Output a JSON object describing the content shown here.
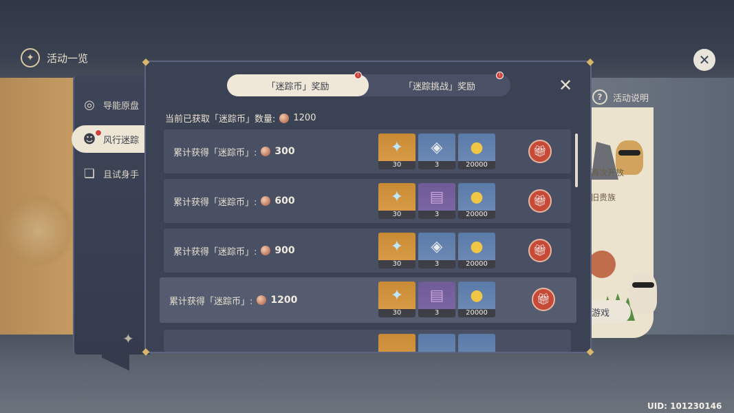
{
  "topbar": {
    "title": "活动一览",
    "close_icon": "close-circle-icon"
  },
  "sidenav": {
    "items": [
      {
        "label": "导能原盘",
        "icon": "target-icon",
        "active": false
      },
      {
        "label": "风行迷踪",
        "icon": "mask-icon",
        "active": true,
        "badge": true
      },
      {
        "label": "且试身手",
        "icon": "cards-icon",
        "active": false
      }
    ]
  },
  "right_panel": {
    "help_label": "活动说明",
    "lines": [
      "再次开放",
      "旧贵族"
    ],
    "button_label": "游戏"
  },
  "dialog": {
    "tabs": [
      {
        "label": "「迷踪币」奖励",
        "active": true,
        "badge": "!"
      },
      {
        "label": "「迷踪挑战」奖励",
        "active": false,
        "badge": "!"
      }
    ],
    "summary": {
      "label": "当前已获取「迷踪币」数量:",
      "value": "1200"
    },
    "row_label": "累计获得「迷踪币」:",
    "rows": [
      {
        "threshold": "300",
        "items": [
          {
            "kind": "primogem",
            "count": "30"
          },
          {
            "kind": "ore",
            "count": "3"
          },
          {
            "kind": "mora",
            "count": "20000"
          }
        ]
      },
      {
        "threshold": "600",
        "items": [
          {
            "kind": "primogem",
            "count": "30"
          },
          {
            "kind": "book",
            "count": "3"
          },
          {
            "kind": "mora",
            "count": "20000"
          }
        ]
      },
      {
        "threshold": "900",
        "items": [
          {
            "kind": "primogem",
            "count": "30"
          },
          {
            "kind": "ore",
            "count": "3"
          },
          {
            "kind": "mora",
            "count": "20000"
          }
        ]
      },
      {
        "threshold": "1200",
        "items": [
          {
            "kind": "primogem",
            "count": "30"
          },
          {
            "kind": "book",
            "count": "3"
          },
          {
            "kind": "mora",
            "count": "20000"
          }
        ]
      }
    ]
  },
  "uid": "UID: 101230146",
  "colors": {
    "accent_gold": "#d9b56a",
    "gift_red": "#c64a37",
    "tab_active": "#efe8d8"
  }
}
